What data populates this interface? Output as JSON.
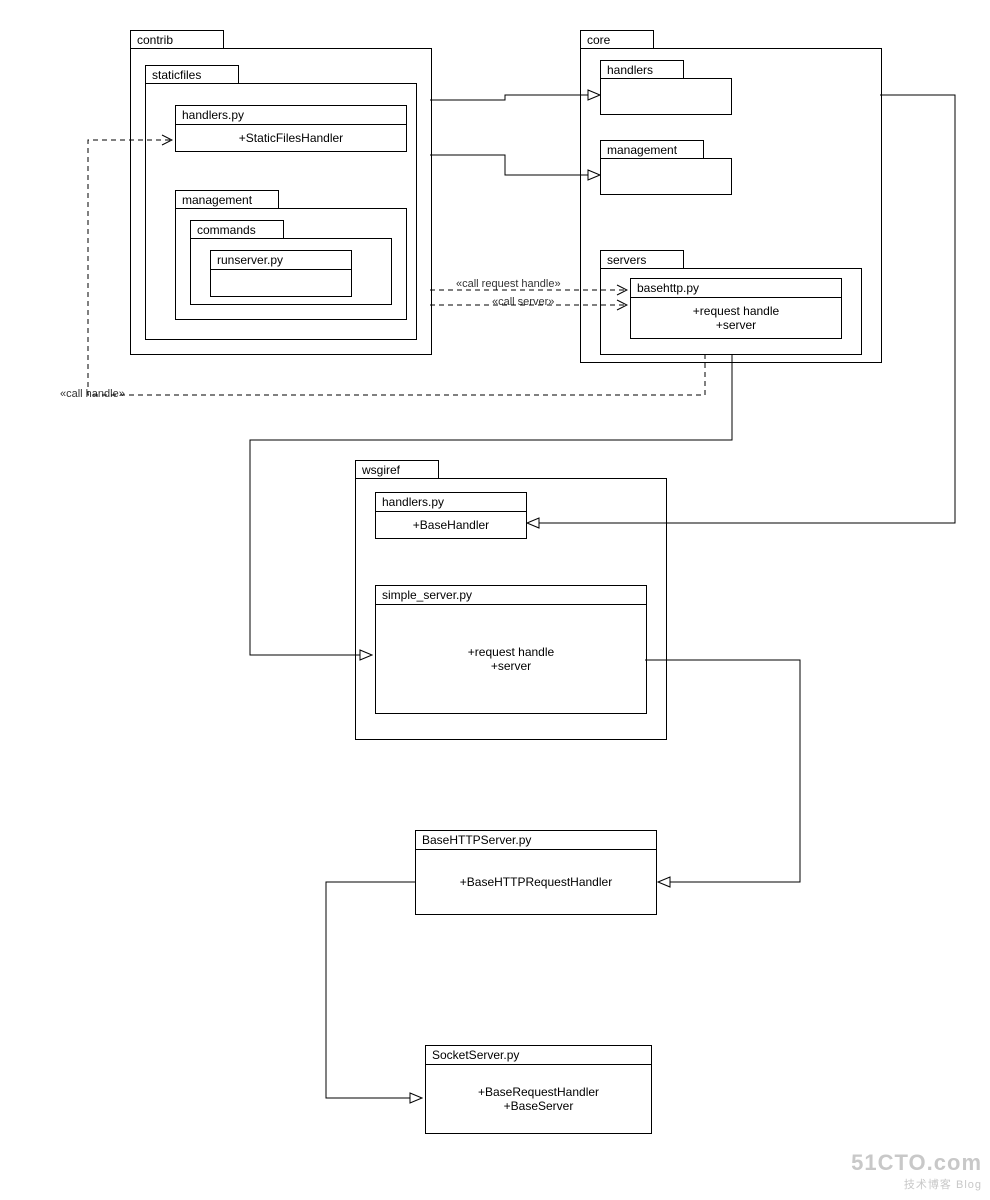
{
  "packages": {
    "contrib": "contrib",
    "staticfiles": "staticfiles",
    "management_contrib": "management",
    "commands": "commands",
    "core": "core",
    "handlers_core": "handlers",
    "management_core": "management",
    "servers": "servers",
    "wsgiref": "wsgiref"
  },
  "classes": {
    "handlers_py_contrib": {
      "title": "handlers.py",
      "body1": "+StaticFilesHandler"
    },
    "runserver_py": {
      "title": "runserver.py",
      "body1": ""
    },
    "basehttp_py": {
      "title": "basehttp.py",
      "body1": "+request handle",
      "body2": "+server"
    },
    "handlers_py_wsgiref": {
      "title": "handlers.py",
      "body1": "+BaseHandler"
    },
    "simple_server_py": {
      "title": "simple_server.py",
      "body1": "+request handle",
      "body2": "+server"
    },
    "basehttpserver_py": {
      "title": "BaseHTTPServer.py",
      "body1": "+BaseHTTPRequestHandler"
    },
    "socketserver_py": {
      "title": "SocketServer.py",
      "body1": "+BaseRequestHandler",
      "body2": "+BaseServer"
    }
  },
  "labels": {
    "call_request_handle": "«call request handle»",
    "call_server": "«call server»",
    "call_handle": "«call handle»"
  },
  "watermark": {
    "line1": "51CTO.com",
    "line2": "技术博客  Blog"
  }
}
